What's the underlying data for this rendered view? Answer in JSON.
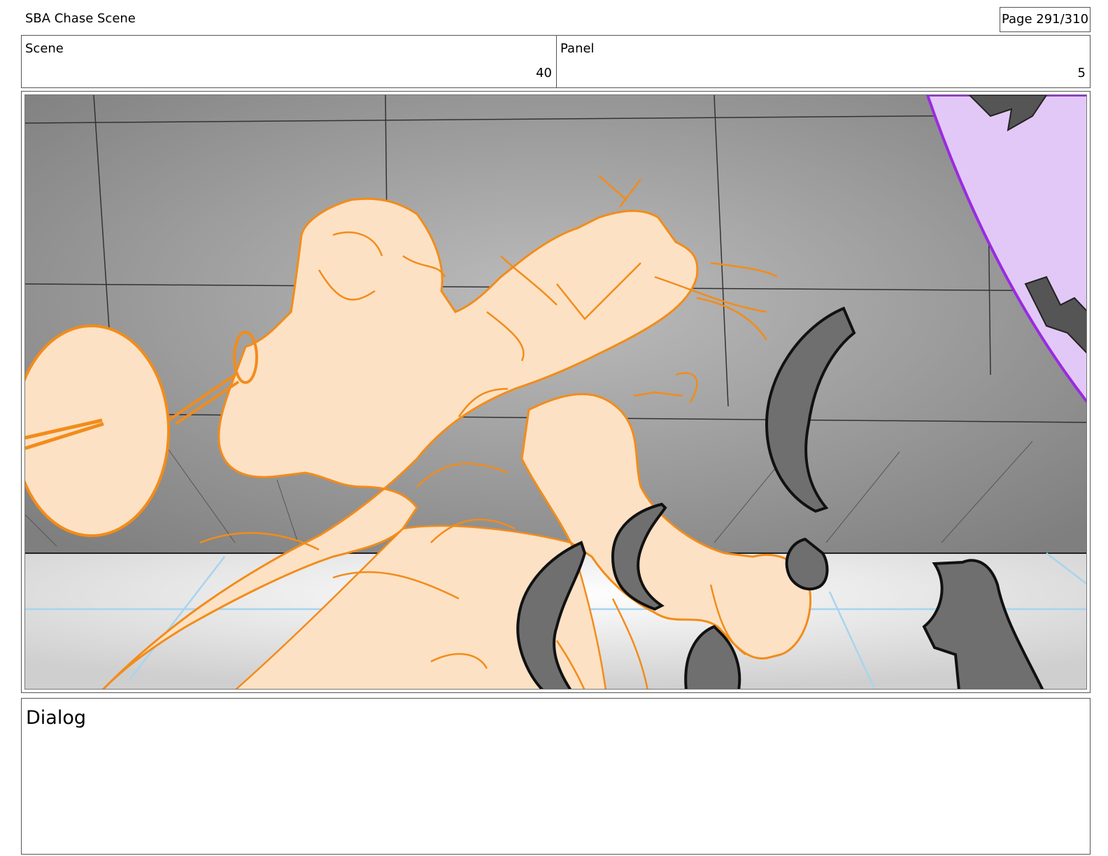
{
  "header": {
    "title": "SBA Chase Scene",
    "page": "Page 291/310"
  },
  "info": {
    "scene_label": "Scene",
    "scene_value": "40",
    "panel_label": "Panel",
    "panel_value": "5"
  },
  "frame": {
    "colors": {
      "wall": "#a9a9a9",
      "floor": "#f2f4f6",
      "sketch_fill": "#fde1c4",
      "sketch_line": "#f28c1a",
      "claw_fill": "#6f6f6f",
      "purple_fill": "#e2c8f7",
      "purple_line": "#9a2be0",
      "floor_grid": "#a8d4ef"
    }
  },
  "dialog": {
    "label": "Dialog"
  }
}
